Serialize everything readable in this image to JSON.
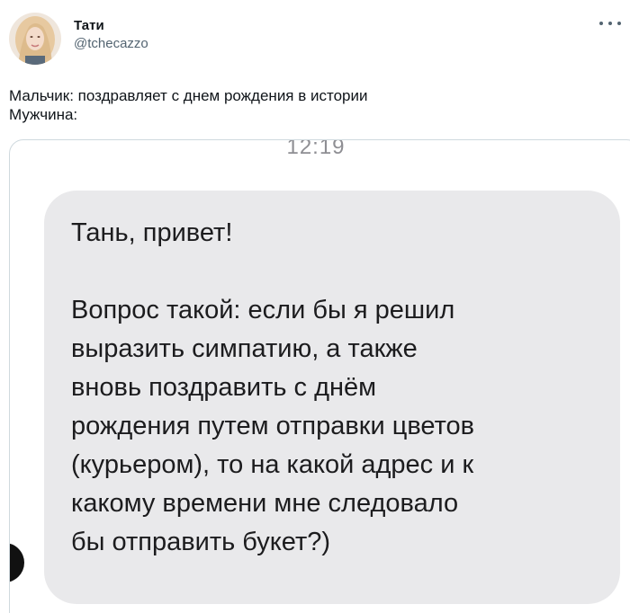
{
  "tweet": {
    "display_name": "Тати",
    "handle": "@tchecazzo",
    "text_lines": [
      "Мальчик: поздравляет с днем рождения в истории",
      "Мужчина:"
    ]
  },
  "screenshot": {
    "timestamp": "12:19",
    "message_lines": [
      "Тань, привет!",
      "",
      "Вопрос такой: если бы я решил",
      "выразить симпатию, а также",
      "вновь поздравить с днём",
      "рождения путем отправки цветов",
      "(курьером), то на какой адрес и к",
      "какому времени мне следовало",
      "бы отправить букет?)"
    ]
  },
  "icons": {
    "avatar": "profile-photo",
    "more": "more-dots-icon"
  },
  "colors": {
    "bubble": "#e9e9eb",
    "handle": "#536471",
    "border": "#cfd9de"
  }
}
